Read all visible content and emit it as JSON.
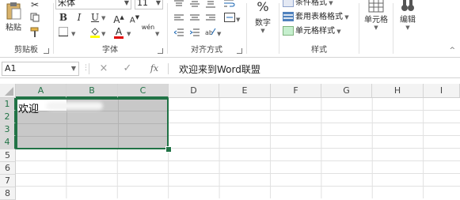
{
  "ribbon": {
    "clipboard": {
      "paste_label": "粘贴",
      "group_label": "剪贴板"
    },
    "font": {
      "font_name": "宋体",
      "font_size": "11",
      "bold": "B",
      "italic": "I",
      "underline": "U",
      "font_color_glyph": "A",
      "phonetic_glyph": "wén",
      "group_label": "字体"
    },
    "alignment": {
      "group_label": "对齐方式"
    },
    "number": {
      "percent": "%",
      "label": "数字"
    },
    "styles": {
      "conditional_format": "条件格式",
      "table_format": "套用表格格式",
      "cell_style": "单元格样式",
      "group_label": "样式"
    },
    "cells": {
      "label": "单元格"
    },
    "editing": {
      "label": "编辑"
    }
  },
  "formula_bar": {
    "name_box": "A1",
    "cancel": "×",
    "enter": "✓",
    "fx": "fx",
    "formula": "欢迎来到Word联盟"
  },
  "sheet": {
    "columns": [
      "A",
      "B",
      "C",
      "D",
      "E",
      "F",
      "G",
      "H",
      "I"
    ],
    "rows": [
      "1",
      "2",
      "3",
      "4",
      "5",
      "6",
      "7",
      "8"
    ],
    "cell_A1": "欢迎",
    "accent": "#217346"
  }
}
